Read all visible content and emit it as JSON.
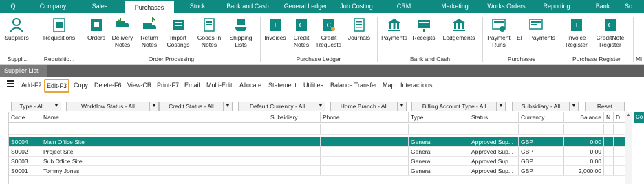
{
  "menu": [
    {
      "label": "iQ"
    },
    {
      "label": "Company"
    },
    {
      "label": "Sales"
    },
    {
      "label": "Purchases"
    },
    {
      "label": "Stock"
    },
    {
      "label": "Bank and Cash"
    },
    {
      "label": "General Ledger"
    },
    {
      "label": "Job Costing"
    },
    {
      "label": "CRM"
    },
    {
      "label": "Marketing"
    },
    {
      "label": "Works Orders"
    },
    {
      "label": "Reporting"
    },
    {
      "label": "Bank"
    },
    {
      "label": "Sc"
    }
  ],
  "ribbon": {
    "buttons": [
      {
        "label": "Suppliers",
        "icon": "suppliers-icon"
      },
      {
        "label": "Requisitions",
        "icon": "requisitions-icon"
      },
      {
        "label": "Orders",
        "icon": "orders-icon"
      },
      {
        "label": "Delivery\nNotes",
        "icon": "delivery-notes-icon"
      },
      {
        "label": "Return\nNotes",
        "icon": "return-notes-icon"
      },
      {
        "label": "Import\nCostings",
        "icon": "import-costings-icon"
      },
      {
        "label": "Goods In\nNotes",
        "icon": "goods-in-icon"
      },
      {
        "label": "Shipping\nLists",
        "icon": "shipping-lists-icon"
      },
      {
        "label": "Invoices",
        "icon": "invoices-icon"
      },
      {
        "label": "Credit\nNotes",
        "icon": "credit-notes-icon"
      },
      {
        "label": "Credit\nRequests",
        "icon": "credit-requests-icon"
      },
      {
        "label": "Journals",
        "icon": "journals-icon"
      },
      {
        "label": "Payments",
        "icon": "payments-icon"
      },
      {
        "label": "Receipts",
        "icon": "receipts-icon"
      },
      {
        "label": "Lodgements",
        "icon": "lodgements-icon"
      },
      {
        "label": "Payment\nRuns",
        "icon": "payment-runs-icon"
      },
      {
        "label": "EFT Payments",
        "icon": "eft-payments-icon"
      },
      {
        "label": "Invoice\nRegister",
        "icon": "invoice-register-icon"
      },
      {
        "label": "CreditNote\nRegister",
        "icon": "creditnote-register-icon"
      }
    ],
    "groups": [
      {
        "label": "Suppli..."
      },
      {
        "label": "Requisitio..."
      },
      {
        "label": "Order Processing"
      },
      {
        "label": "Purchase Ledger"
      },
      {
        "label": "Bank and Cash"
      },
      {
        "label": "Purchases"
      },
      {
        "label": "Purchase Register"
      },
      {
        "label": "Mi"
      }
    ]
  },
  "tab": {
    "label": "Supplier List",
    "close": "✕"
  },
  "toolbar": [
    {
      "label": "Add-F2"
    },
    {
      "label": "Edit-F3"
    },
    {
      "label": "Copy"
    },
    {
      "label": "Delete-F6"
    },
    {
      "label": "View-CR"
    },
    {
      "label": "Print-F7"
    },
    {
      "label": "Email"
    },
    {
      "label": "Multi-Edit"
    },
    {
      "label": "Allocate"
    },
    {
      "label": "Statement"
    },
    {
      "label": "Utilities"
    },
    {
      "label": "Balance Transfer"
    },
    {
      "label": "Map"
    },
    {
      "label": "Interactions"
    }
  ],
  "filters": [
    {
      "label": "Type - All"
    },
    {
      "label": "Workflow Status - All"
    },
    {
      "label": "Credit Status - All"
    },
    {
      "label": "Default Currency - All"
    },
    {
      "label": "Home Branch - All"
    },
    {
      "label": "Billing Account Type - All"
    },
    {
      "label": "Subsidiary - All"
    },
    {
      "label": "Reset"
    }
  ],
  "table": {
    "columns": [
      "Code",
      "Name",
      "Subsidiary",
      "Phone",
      "Type",
      "Status",
      "Currency",
      "Balance",
      "N",
      "D"
    ],
    "rows": [
      {
        "code": "S0004",
        "name": "Main Office Site",
        "subsidiary": "",
        "phone": "",
        "type": "General",
        "status": "Approved Sup...",
        "currency": "GBP",
        "balance": "0.00",
        "selected": true
      },
      {
        "code": "S0002",
        "name": "Project Site",
        "subsidiary": "",
        "phone": "",
        "type": "General",
        "status": "Approved Sup...",
        "currency": "GBP",
        "balance": "0.00",
        "selected": false
      },
      {
        "code": "S0003",
        "name": "Sub Office Site",
        "subsidiary": "",
        "phone": "",
        "type": "General",
        "status": "Approved Sup...",
        "currency": "GBP",
        "balance": "0.00",
        "selected": false
      },
      {
        "code": "S0001",
        "name": "Tommy Jones",
        "subsidiary": "",
        "phone": "",
        "type": "General",
        "status": "Approved Sup...",
        "currency": "GBP",
        "balance": "2,000.00",
        "selected": false
      }
    ]
  },
  "right_panel": {
    "header": "Co"
  },
  "colors": {
    "accent": "#0f8a80",
    "highlight": "#e8a33d"
  }
}
